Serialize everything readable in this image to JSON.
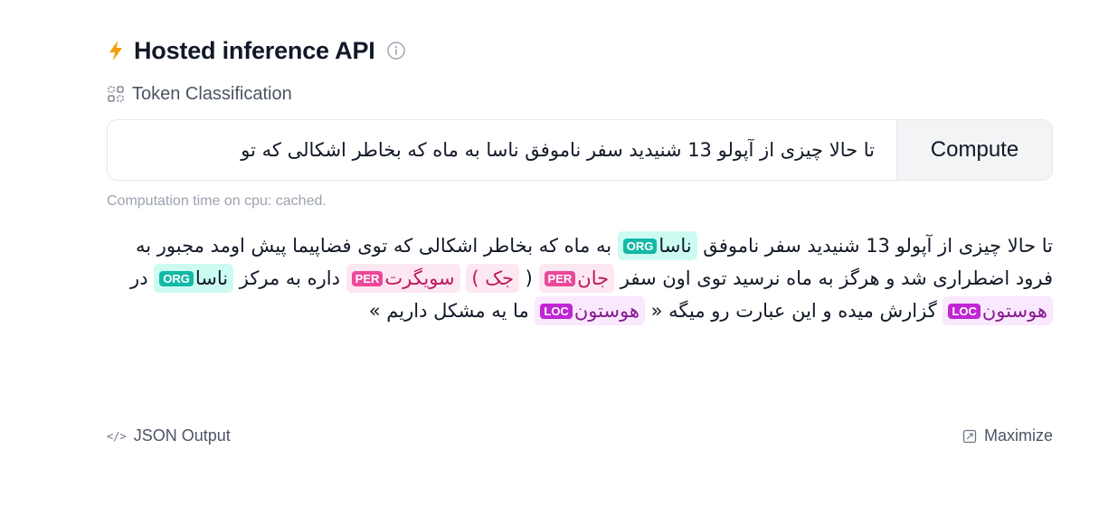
{
  "header": {
    "title": "Hosted inference API",
    "bolt_icon": "lightning-bolt-icon",
    "info_icon": "info-circle-icon",
    "bolt_color": "#f59e0b"
  },
  "task": {
    "label": "Token Classification",
    "icon": "token-classification-icon"
  },
  "input": {
    "value": "تا حالا چیزی از آپولو 13 شنیدید سفر ناموفق ناسا به ماه که بخاطر اشکالی که تو"
  },
  "compute_label": "Compute",
  "computation_time": "Computation time on cpu: cached.",
  "output": {
    "segments": [
      {
        "text": "تا حالا چیزی از آپولو 13 شنیدید سفر ناموفق "
      },
      {
        "text": "ناسا",
        "entity": "ORG"
      },
      {
        "text": " به ماه که بخاطر اشکالی که توی فضاپیما پیش اومد مجبور به فرود اضطراری شد و هرگز به ماه نرسید توی اون سفر "
      },
      {
        "text": "جان",
        "entity": "PER"
      },
      {
        "text": " ( "
      },
      {
        "text": "جک )",
        "entity": "PER_plain"
      },
      {
        "text": " "
      },
      {
        "text": "سویگرت",
        "entity": "PER"
      },
      {
        "text": " داره به مرکز "
      },
      {
        "text": "ناسا",
        "entity": "ORG"
      },
      {
        "text": " در "
      },
      {
        "text": "هوستون",
        "entity": "LOC"
      },
      {
        "text": " گزارش میده و این عبارت رو میگه « "
      },
      {
        "text": "هوستون",
        "entity": "LOC"
      },
      {
        "text": " ما یه مشکل داریم »"
      }
    ],
    "colors": {
      "ORG": "#14b8a6",
      "PER": "#ec4899",
      "LOC": "#c026d3"
    }
  },
  "footer": {
    "json_label": "JSON Output",
    "json_icon": "code-icon",
    "maximize_label": "Maximize",
    "maximize_icon": "maximize-icon"
  }
}
